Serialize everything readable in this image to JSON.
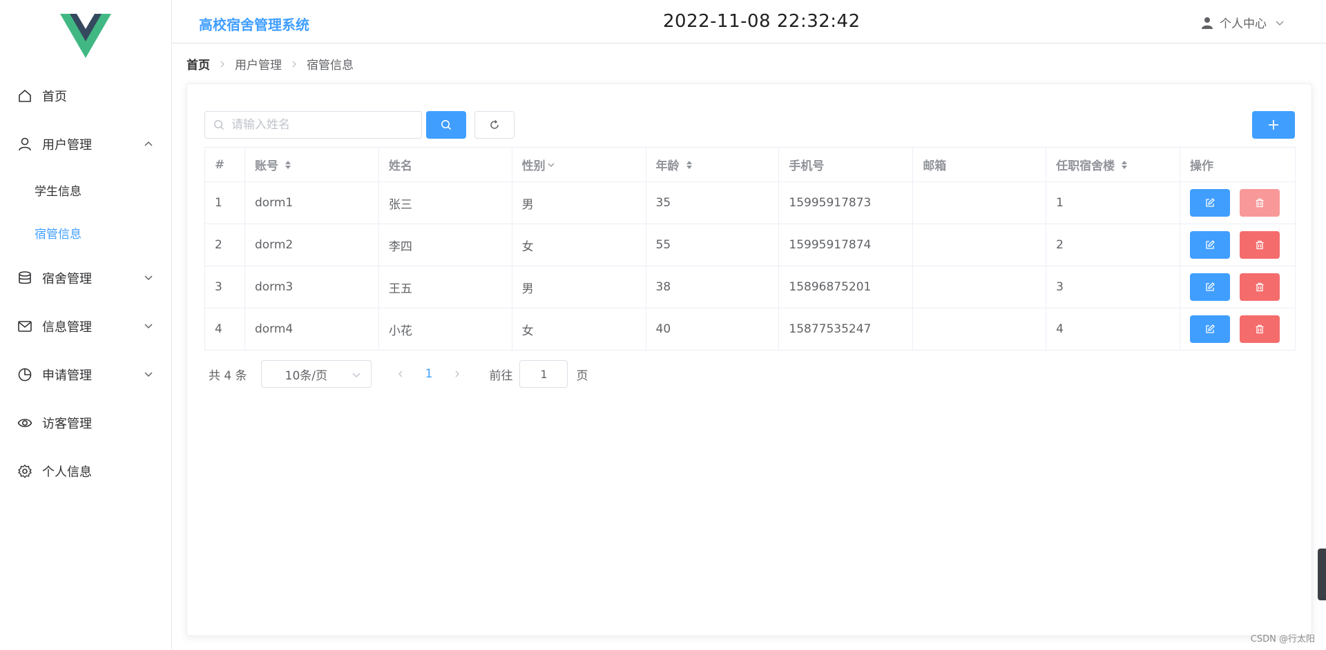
{
  "colors": {
    "primary": "#409eff",
    "danger": "#f56c6c",
    "text": "#606266",
    "header_text": "#909399"
  },
  "sidebar": {
    "logo": "vue-logo",
    "items": [
      {
        "label": "首页",
        "icon": "home-icon"
      },
      {
        "label": "用户管理",
        "icon": "user-icon",
        "expanded": true,
        "children": [
          {
            "label": "学生信息"
          },
          {
            "label": "宿管信息",
            "active": true
          }
        ]
      },
      {
        "label": "宿舍管理",
        "icon": "database-icon"
      },
      {
        "label": "信息管理",
        "icon": "message-icon"
      },
      {
        "label": "申请管理",
        "icon": "pie-chart-icon"
      },
      {
        "label": "访客管理",
        "icon": "eye-icon"
      },
      {
        "label": "个人信息",
        "icon": "gear-icon"
      }
    ]
  },
  "header": {
    "title": "高校宿舍管理系统",
    "datetime": "2022-11-08 22:32:42",
    "user_menu": "个人中心"
  },
  "breadcrumb": [
    "首页",
    "用户管理",
    "宿管信息"
  ],
  "search": {
    "placeholder": "请输入姓名",
    "value": ""
  },
  "table": {
    "columns": [
      "#",
      "账号",
      "姓名",
      "性别",
      "年龄",
      "手机号",
      "邮箱",
      "任职宿舍楼",
      "操作"
    ],
    "rows": [
      {
        "index": "1",
        "account": "dorm1",
        "name": "张三",
        "gender": "男",
        "age": "35",
        "phone": "15995917873",
        "email": "",
        "building": "1"
      },
      {
        "index": "2",
        "account": "dorm2",
        "name": "李四",
        "gender": "女",
        "age": "55",
        "phone": "15995917874",
        "email": "",
        "building": "2"
      },
      {
        "index": "3",
        "account": "dorm3",
        "name": "王五",
        "gender": "男",
        "age": "38",
        "phone": "15896875201",
        "email": "",
        "building": "3"
      },
      {
        "index": "4",
        "account": "dorm4",
        "name": "小花",
        "gender": "女",
        "age": "40",
        "phone": "15877535247",
        "email": "",
        "building": "4"
      }
    ]
  },
  "pagination": {
    "total": "共 4 条",
    "page_size": "10条/页",
    "current_page": "1",
    "goto_label": "前往",
    "goto_value": "1",
    "goto_unit": "页"
  },
  "watermark": "CSDN @行太阳"
}
